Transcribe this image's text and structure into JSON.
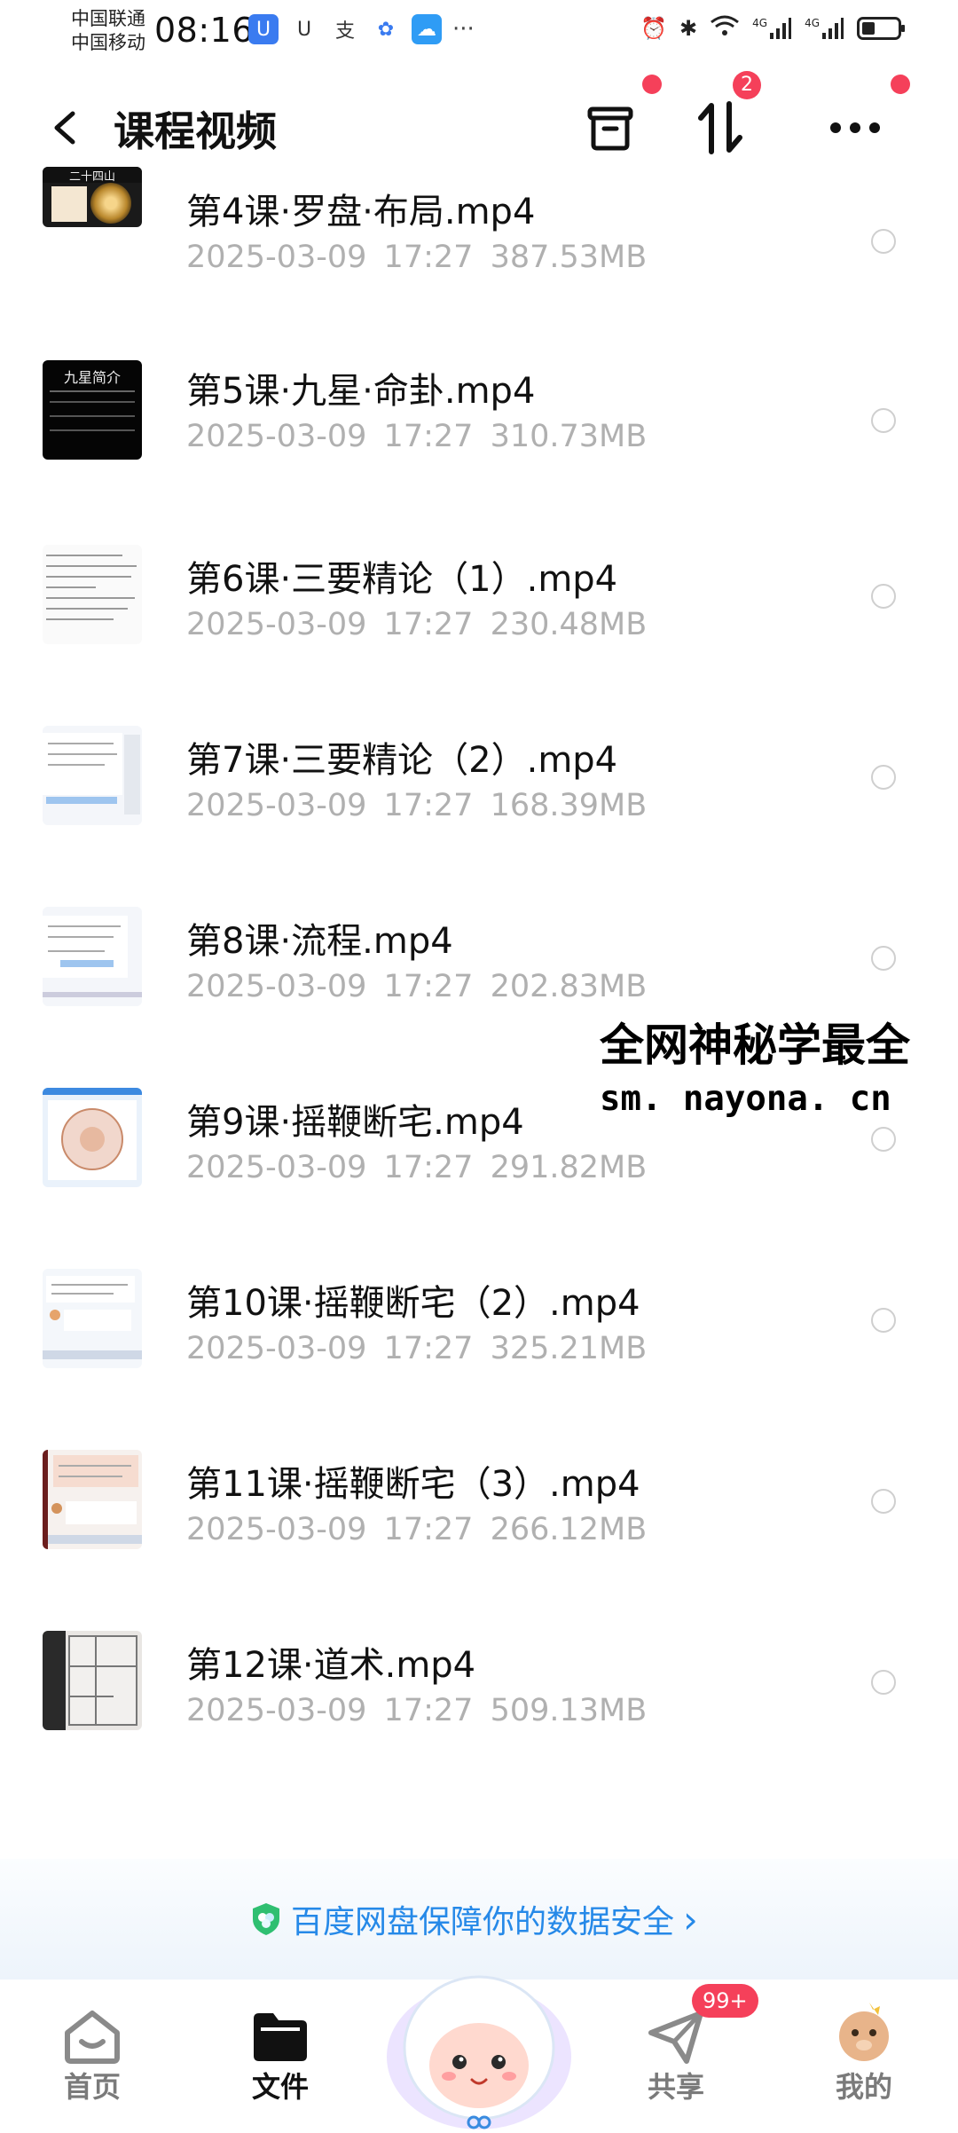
{
  "status_bar": {
    "carrier1": "中国联通",
    "carrier2": "中国移动",
    "time": "08:16",
    "network1": "4G",
    "network2": "4G"
  },
  "header": {
    "title": "课程视频",
    "sort_badge": "2"
  },
  "files": [
    {
      "name": "第4课·罗盘·布局.mp4",
      "date": "2025-03-09",
      "time": "17:27",
      "size": "387.53MB",
      "thumb_text": "二十四山"
    },
    {
      "name": "第5课·九星·命卦.mp4",
      "date": "2025-03-09",
      "time": "17:27",
      "size": "310.73MB",
      "thumb_text": "九星简介"
    },
    {
      "name": "第6课·三要精论（1）.mp4",
      "date": "2025-03-09",
      "time": "17:27",
      "size": "230.48MB"
    },
    {
      "name": "第7课·三要精论（2）.mp4",
      "date": "2025-03-09",
      "time": "17:27",
      "size": "168.39MB"
    },
    {
      "name": "第8课·流程.mp4",
      "date": "2025-03-09",
      "time": "17:27",
      "size": "202.83MB"
    },
    {
      "name": "第9课·摇鞭断宅.mp4",
      "date": "2025-03-09",
      "time": "17:27",
      "size": "291.82MB"
    },
    {
      "name": "第10课·摇鞭断宅（2）.mp4",
      "date": "2025-03-09",
      "time": "17:27",
      "size": "325.21MB"
    },
    {
      "name": "第11课·摇鞭断宅（3）.mp4",
      "date": "2025-03-09",
      "time": "17:27",
      "size": "266.12MB"
    },
    {
      "name": "第12课·道术.mp4",
      "date": "2025-03-09",
      "time": "17:27",
      "size": "509.13MB"
    }
  ],
  "watermark": {
    "line1": "全网神秘学最全",
    "line2": "sm. nayona. cn"
  },
  "security_banner": {
    "text": "百度网盘保障你的数据安全",
    "chevron": "›"
  },
  "tabs": [
    {
      "label": "首页",
      "icon": "home-icon",
      "active": false
    },
    {
      "label": "文件",
      "icon": "folder-icon",
      "active": true
    },
    {
      "label": "共享",
      "icon": "send-icon",
      "active": false,
      "badge": "99+"
    },
    {
      "label": "我的",
      "icon": "avatar-icon",
      "active": false
    }
  ],
  "colors": {
    "accent": "#2689e8",
    "badge": "#f5405a",
    "meta_text": "#b0b0b0"
  }
}
